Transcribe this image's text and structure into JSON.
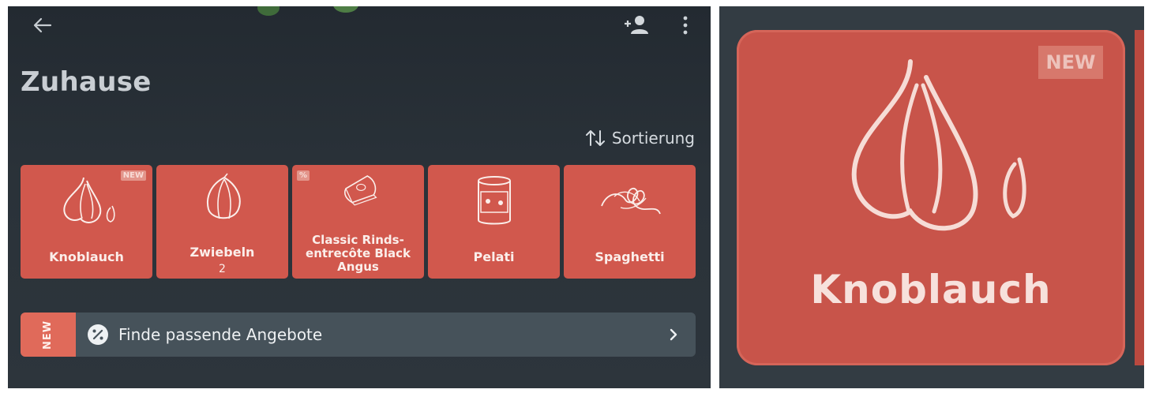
{
  "header": {
    "title": "Zuhause",
    "back_icon": "arrow-left-icon",
    "add_person_icon": "add-person-icon",
    "more_icon": "more-vertical-icon"
  },
  "sort": {
    "label": "Sortierung",
    "icon": "sort-arrows-icon"
  },
  "tiles": [
    {
      "name": "Knoblauch",
      "badge": "NEW",
      "icon": "garlic-icon"
    },
    {
      "name": "Zwiebeln",
      "qty": "2",
      "icon": "onion-icon"
    },
    {
      "name": "Classic Rinds-entrecôte Black Angus",
      "badge": "%",
      "icon": "meat-icon"
    },
    {
      "name": "Pelati",
      "icon": "tin-can-icon"
    },
    {
      "name": "Spaghetti",
      "icon": "spaghetti-icon"
    }
  ],
  "offer": {
    "tag": "NEW",
    "text": "Finde passende Angebote",
    "icon": "percent-icon"
  },
  "zoom": {
    "name": "Knoblauch",
    "badge": "NEW"
  },
  "colors": {
    "tile": "#d1584d",
    "background": "#2a3239",
    "offer_bar": "#46525a",
    "new_tag": "#e06a5a"
  }
}
